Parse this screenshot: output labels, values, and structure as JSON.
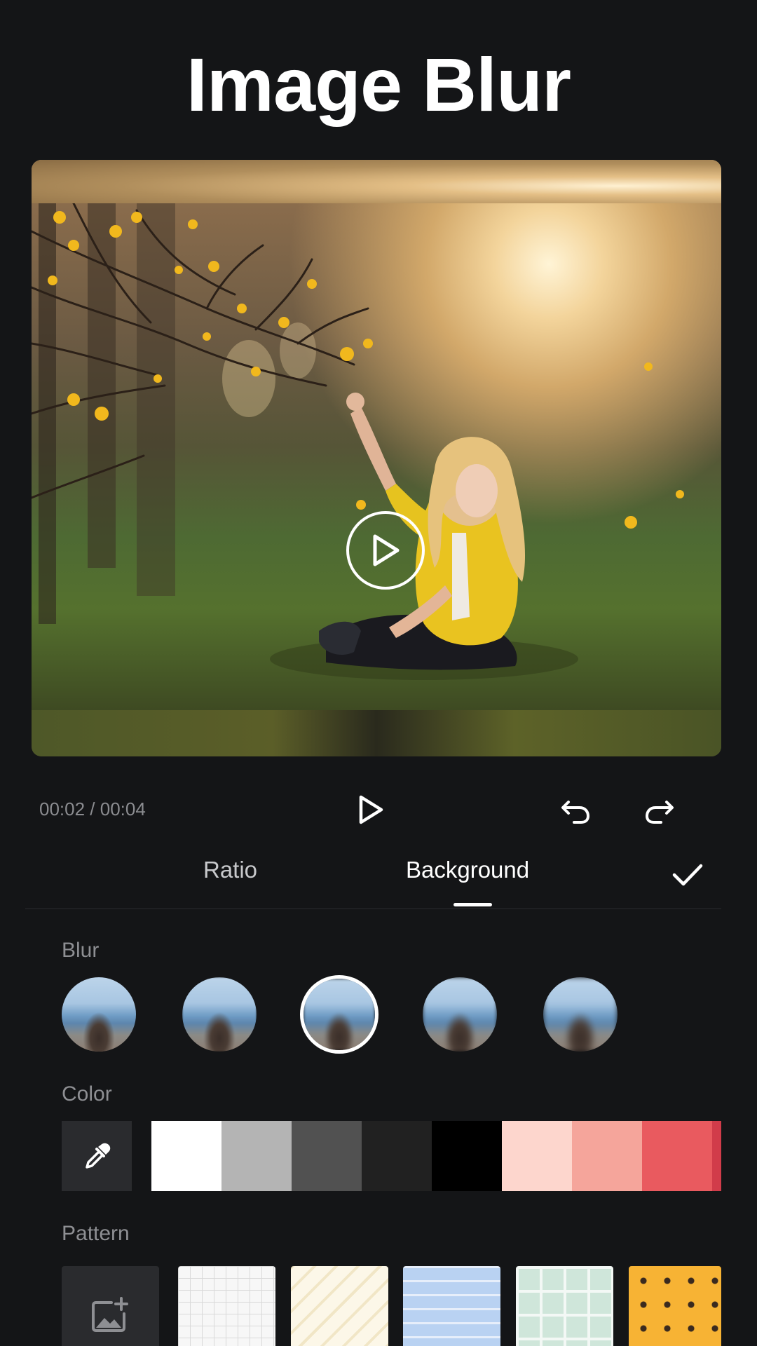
{
  "header": {
    "title": "Image Blur"
  },
  "player": {
    "time": "00:02 / 00:04"
  },
  "tabs": [
    {
      "label": "Ratio",
      "active": false
    },
    {
      "label": "Background",
      "active": true
    }
  ],
  "sections": {
    "blur_label": "Blur",
    "color_label": "Color",
    "pattern_label": "Pattern"
  },
  "blur": {
    "option_count": 5,
    "selected_index": 2
  },
  "colors": [
    "#ffffff",
    "#b4b4b4",
    "#515151",
    "#212121",
    "#000000",
    "#fdd6cd",
    "#f5a59b",
    "#e95a5f",
    "#d13c4a"
  ],
  "patterns": [
    "grid",
    "diagonal-lines",
    "horizontal-stripes",
    "checker",
    "polka-dots"
  ],
  "icons": {
    "play": "play-icon",
    "undo": "undo-icon",
    "redo": "redo-icon",
    "confirm": "check-icon",
    "eyedropper": "eyedropper-icon",
    "add_image": "add-image-icon"
  },
  "accent": "#ffffff"
}
